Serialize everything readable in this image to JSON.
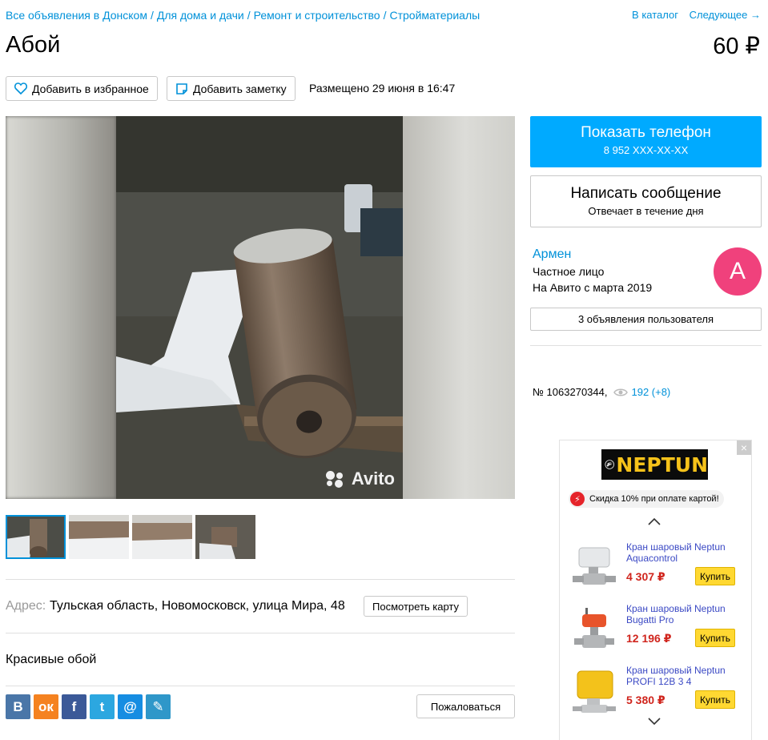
{
  "breadcrumbs": [
    "Все объявления в Донском",
    "Для дома и дачи",
    "Ремонт и строительство",
    "Стройматериалы"
  ],
  "topnav": {
    "catalog": "В каталог",
    "next": "Следующее →"
  },
  "listing": {
    "title": "Абой",
    "price": "60 ₽",
    "add_favorite": "Добавить в избранное",
    "add_note": "Добавить заметку",
    "posted": "Размещено 29 июня в 16:47",
    "watermark": "Avito",
    "address_label": "Адрес:",
    "address": "Тульская область, Новомосковск, улица Мира, 48",
    "show_map": "Посмотреть карту",
    "description": "Красивые обой",
    "complain": "Пожаловаться",
    "thumbnails_count": 4
  },
  "contact": {
    "show_phone": "Показать телефон",
    "phone_masked": "8 952 XXX-XX-XX",
    "write_message": "Написать сообщение",
    "reply_time": "Отвечает в течение дня"
  },
  "seller": {
    "name": "Армен",
    "type": "Частное лицо",
    "since": "На Авито с марта 2019",
    "avatar_letter": "А",
    "avatar_color": "#f0417c",
    "ads_link": "3 объявления пользователя"
  },
  "stats": {
    "item_number": "№ 1063270344,",
    "views": "192 (+8)"
  },
  "share_buttons": [
    {
      "name": "vk-icon",
      "glyph": "В",
      "color": "#4a76a8"
    },
    {
      "name": "odnoklassniki-icon",
      "glyph": "ок",
      "color": "#f58220"
    },
    {
      "name": "facebook-icon",
      "glyph": "f",
      "color": "#3b5998"
    },
    {
      "name": "twitter-icon",
      "glyph": "t",
      "color": "#2ca7e0"
    },
    {
      "name": "mailru-icon",
      "glyph": "@",
      "color": "#168de2"
    },
    {
      "name": "livejournal-icon",
      "glyph": "✎",
      "color": "#2f97c9"
    }
  ],
  "ad": {
    "close": "×",
    "brand": "NEPTUN",
    "promo": "Скидка 10% при оплате картой!",
    "products": [
      {
        "name": "Кран шаровый Neptun Aquacontrol",
        "price": "4 307 ₽",
        "buy": "Купить"
      },
      {
        "name": "Кран шаровый Neptun Bugatti Pro",
        "price": "12 196 ₽",
        "buy": "Купить"
      },
      {
        "name": "Кран шаровый Neptun PROFI 12В 3 4",
        "price": "5 380 ₽",
        "buy": "Купить"
      }
    ]
  },
  "colors": {
    "accent": "#0091d9",
    "phone_button": "#00aaff",
    "ad_price": "#d0251d",
    "buy_button": "#ffd832"
  }
}
